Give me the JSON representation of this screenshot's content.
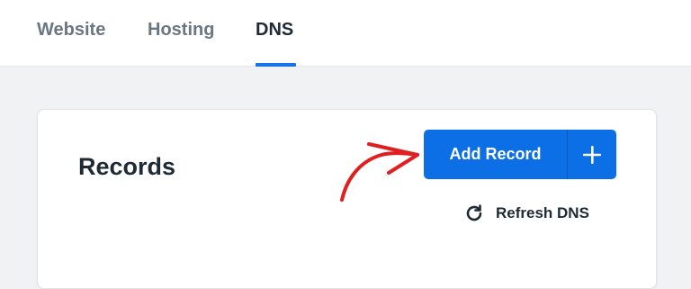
{
  "tabs": [
    {
      "label": "Website",
      "active": false
    },
    {
      "label": "Hosting",
      "active": false
    },
    {
      "label": "DNS",
      "active": true
    }
  ],
  "records": {
    "title": "Records",
    "add_record_label": "Add Record",
    "add_icon": "plus-icon",
    "refresh_label": "Refresh DNS",
    "refresh_icon": "refresh-icon"
  },
  "annotation": {
    "arrow_icon": "red-hand-drawn-arrow",
    "color": "#e02020"
  },
  "colors": {
    "accent": "#0d6fe5",
    "tab_underline": "#1a73e8",
    "text_dark": "#1f2a37",
    "text_muted": "#6b7684"
  }
}
